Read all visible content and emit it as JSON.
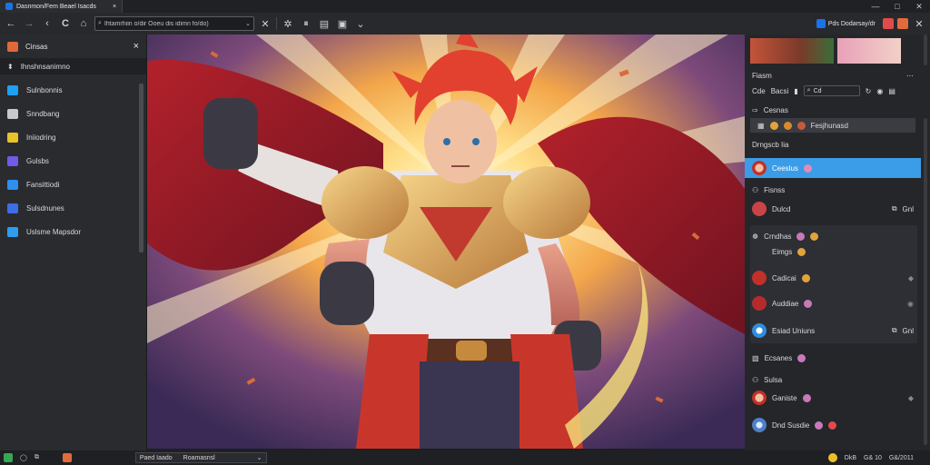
{
  "titlebar": {
    "tab_title": "Dasnmon/Fem Beael Isacds",
    "tab_close": "×",
    "window_controls": {
      "minimize": "—",
      "maximize": "□",
      "close": "✕"
    }
  },
  "toolbar": {
    "back": "←",
    "forward": "→",
    "reload": "C",
    "url_text": "Ihtamrhiin o/dir Ooeu dis idimn fo/do)",
    "clear": "✕",
    "account_label": "Pds Dodarsay/dr",
    "colors": {
      "accent_blue": "#1a73e8",
      "badge_red": "#e14b4b",
      "badge_orange": "#e26b3b"
    }
  },
  "leftpanel": {
    "header": "Cinsas",
    "close": "×",
    "subheader": "Ihnshnsanimno",
    "items": [
      {
        "label": "Sulnbonnis",
        "icon": "twitter-icon",
        "color": "#1da1f2"
      },
      {
        "label": "Snndbang",
        "icon": "plugin-icon",
        "color": "#c8c9cc"
      },
      {
        "label": "Iniiodring",
        "icon": "folder-icon",
        "color": "#e9c228"
      },
      {
        "label": "Gulsbs",
        "icon": "pen-icon",
        "color": "#6c5ce7"
      },
      {
        "label": "Fansittiodi",
        "icon": "window-icon",
        "color": "#2e8ff0"
      },
      {
        "label": "Sulsdnunes",
        "icon": "edit-icon",
        "color": "#3b6ee8"
      },
      {
        "label": "Uslsme Mapsdor",
        "icon": "monitor-icon",
        "color": "#2e9cf0"
      }
    ]
  },
  "rightpanel": {
    "panel_title": "Fiasm",
    "toolbar_row": {
      "a": "Cde",
      "b": "Bacsi",
      "search": "Cd"
    },
    "section1": "Cesnas",
    "highlighted_item": "Fesjhunasd",
    "plain_item": "Drngscb Iia",
    "selected_item": "Ceeslus",
    "section2": "Fisnss",
    "members": [
      {
        "name": "Dulcd",
        "action": "Gnl"
      },
      {
        "name": "Crndhas",
        "sub": "Eimgs"
      },
      {
        "name": "Cadicai"
      },
      {
        "name": "Auddiae"
      },
      {
        "name": "Esiad Uniuns",
        "action": "Gnl"
      },
      {
        "name": "Ecsanes"
      },
      {
        "name": "Ganiste"
      },
      {
        "name": "Dnd Susdie"
      }
    ],
    "section3": "Sulsa"
  },
  "statusbar": {
    "box1": "Paed Iaado",
    "box2": "Roamasnsl",
    "right_items": [
      "DkB",
      "G& 10",
      "G&/2011"
    ]
  }
}
